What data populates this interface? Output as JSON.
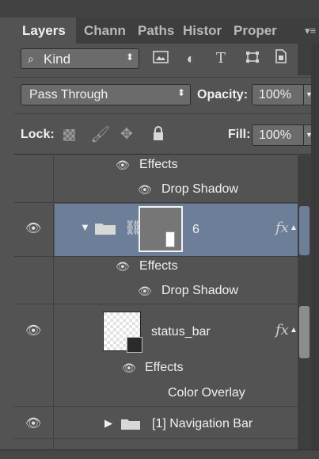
{
  "tabs": [
    {
      "label": "Layers",
      "active": true
    },
    {
      "label": "Chann",
      "active": false
    },
    {
      "label": "Paths",
      "active": false
    },
    {
      "label": "Histor",
      "active": false
    },
    {
      "label": "Proper",
      "active": false
    }
  ],
  "filter": {
    "kind_label": "Kind"
  },
  "blend_mode": "Pass Through",
  "opacity": {
    "label": "Opacity:",
    "value": "100%"
  },
  "lock_label": "Lock:",
  "fill": {
    "label": "Fill:",
    "value": "100%"
  },
  "layers": {
    "top_effects": {
      "effects_label": "Effects",
      "drop_shadow_label": "Drop Shadow"
    },
    "group6": {
      "name": "6",
      "effects_label": "Effects",
      "drop_shadow_label": "Drop Shadow",
      "fx": "fx"
    },
    "status_bar": {
      "name": "status_bar",
      "effects_label": "Effects",
      "color_overlay_label": "Color Overlay",
      "fx": "fx"
    },
    "navigation_bar": {
      "name": "[1] Navigation Bar"
    }
  },
  "colors": {
    "panel": "#535353",
    "selected_row": "#6d7f98",
    "tab_bar": "#3e3e3e"
  }
}
